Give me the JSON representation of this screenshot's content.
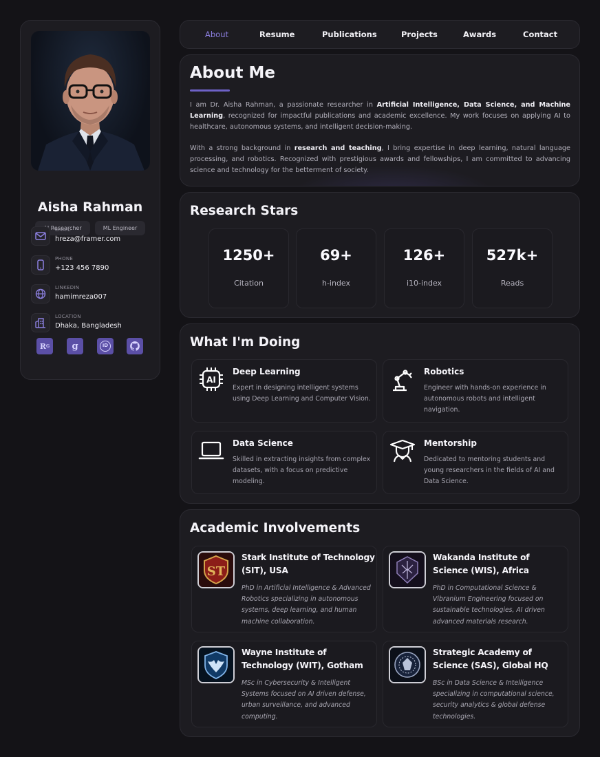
{
  "colors": {
    "background": "#141317",
    "card": "#1d1c21",
    "accent": "#6e62c8",
    "active_nav": "#8c7fe0",
    "social_bg": "#5b4fa6"
  },
  "profile": {
    "name": "Aisha Rahman",
    "tags": [
      "AI Researcher",
      "ML Engineer"
    ],
    "contacts": [
      {
        "icon": "mail-icon",
        "label": "EMAIL",
        "value": "hreza@framer.com"
      },
      {
        "icon": "phone-icon",
        "label": "PHONE",
        "value": "+123 456 7890"
      },
      {
        "icon": "globe-icon",
        "label": "LINKEDIN",
        "value": "hamimreza007"
      },
      {
        "icon": "building-icon",
        "label": "LOCATION",
        "value": "Dhaka, Bangladesh"
      }
    ],
    "socials": [
      {
        "icon": "researchgate-icon",
        "text": "R",
        "sup": "G"
      },
      {
        "icon": "google-scholar-icon",
        "text": "g",
        "sup": ""
      },
      {
        "icon": "orcid-icon",
        "text": "iD",
        "sup": ""
      },
      {
        "icon": "github-icon",
        "text": "",
        "sup": ""
      }
    ]
  },
  "nav": {
    "items": [
      "About",
      "Resume",
      "Publications",
      "Projects",
      "Awards",
      "Contact"
    ],
    "active": "About"
  },
  "about": {
    "title": "About Me",
    "p1": {
      "a": "I am Dr. Aisha Rahman, a passionate researcher in ",
      "b": "Artificial Intelligence, Data Science, and Machine Learning",
      "c": ", recognized for impactful publications and academic excellence. My work focuses on applying AI to healthcare, autonomous systems, and intelligent decision-making."
    },
    "p2": {
      "a": "With a strong background in ",
      "b": "research and teaching",
      "c": ", I bring expertise in deep learning, natural language processing, and robotics. Recognized with prestigious awards and fellowships, I am committed to advancing science and technology for the betterment of society."
    }
  },
  "stats": {
    "title": "Research Stars",
    "items": [
      {
        "value": "1250+",
        "label": "Citation"
      },
      {
        "value": "69+",
        "label": "h-index"
      },
      {
        "value": "126+",
        "label": "i10-index"
      },
      {
        "value": "527k+",
        "label": "Reads"
      }
    ]
  },
  "doing": {
    "title": "What I'm Doing",
    "items": [
      {
        "icon": "ai-chip-icon",
        "title": "Deep Learning",
        "desc": "Expert in designing intelligent systems using Deep Learning and Computer Vision."
      },
      {
        "icon": "robot-arm-icon",
        "title": "Robotics",
        "desc": "Engineer with hands-on experience in autonomous robots and intelligent navigation."
      },
      {
        "icon": "laptop-icon",
        "title": "Data Science",
        "desc": "Skilled in extracting insights from complex datasets, with a focus on predictive modeling."
      },
      {
        "icon": "graduate-icon",
        "title": "Mentorship",
        "desc": "Dedicated to mentoring students and young researchers in the fields of AI and Data Science."
      }
    ]
  },
  "academic": {
    "title": "Academic Involvements",
    "items": [
      {
        "logo": "stark-logo-icon",
        "title": "Stark Institute of Technology (SIT), USA",
        "desc": "PhD in Artificial Intelligence & Advanced Robotics specializing in autonomous systems, deep learning, and human machine collaboration."
      },
      {
        "logo": "wakanda-logo-icon",
        "title": "Wakanda Institute of Science (WIS), Africa",
        "desc": "PhD in Computational Science & Vibranium Engineering focused on sustainable technologies, AI driven advanced materials research."
      },
      {
        "logo": "wayne-logo-icon",
        "title": "Wayne Institute of Technology (WIT), Gotham",
        "desc": "MSc in Cybersecurity & Intelligent Systems focused on AI driven defense, urban surveillance, and advanced computing."
      },
      {
        "logo": "sas-logo-icon",
        "title": "Strategic Academy of Science (SAS), Global HQ",
        "desc": "BSc in Data Science & Intelligence specializing in computational science, security analytics & global defense technologies."
      }
    ]
  }
}
